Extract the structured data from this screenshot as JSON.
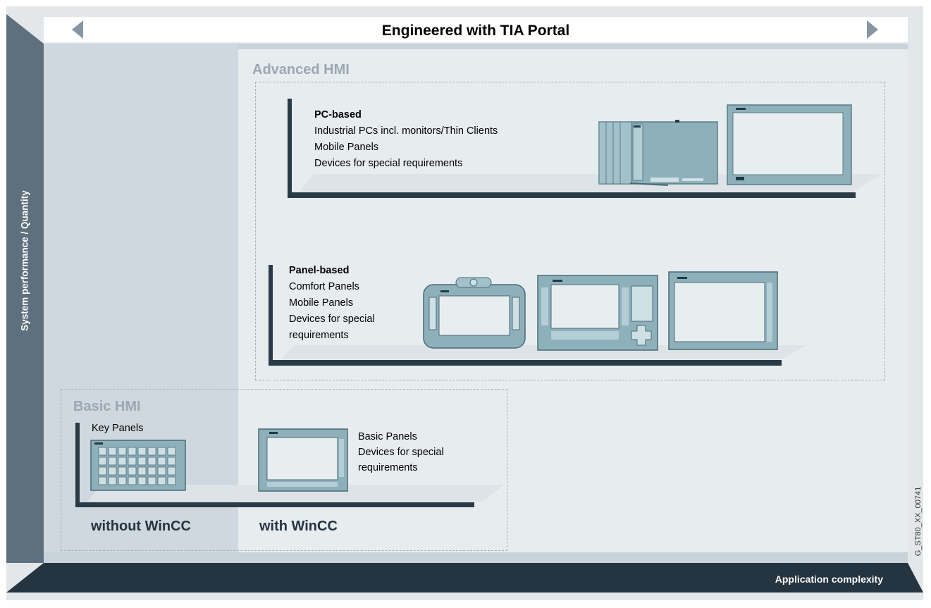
{
  "banner": {
    "title": "Engineered with TIA Portal"
  },
  "axes": {
    "y_label": "System performance / Quantity",
    "x_label": "Application complexity"
  },
  "advanced_hmi": {
    "title": "Advanced HMI",
    "pc_based": {
      "heading": "PC-based",
      "lines": [
        "Industrial PCs incl. monitors/Thin Clients",
        "Mobile Panels",
        "Devices for special requirements"
      ]
    },
    "panel_based": {
      "heading": "Panel-based",
      "lines": [
        "Comfort Panels",
        "Mobile Panels",
        "Devices for special",
        "requirements"
      ]
    }
  },
  "basic_hmi": {
    "title": "Basic HMI",
    "key_panels": "Key Panels",
    "basic_panels_lines": [
      "Basic Panels",
      "Devices for special",
      "requirements"
    ],
    "without_wincc": "without WinCC",
    "with_wincc": "with WinCC"
  },
  "figure_code": "G_ST80_XX_00741",
  "colors": {
    "dark_navy": "#2a3b47",
    "axis_gray": "#5e707d",
    "group_title_gray": "#9aa8b3",
    "device_teal": "#7fa9b4",
    "screen_light": "#e8eef0"
  }
}
